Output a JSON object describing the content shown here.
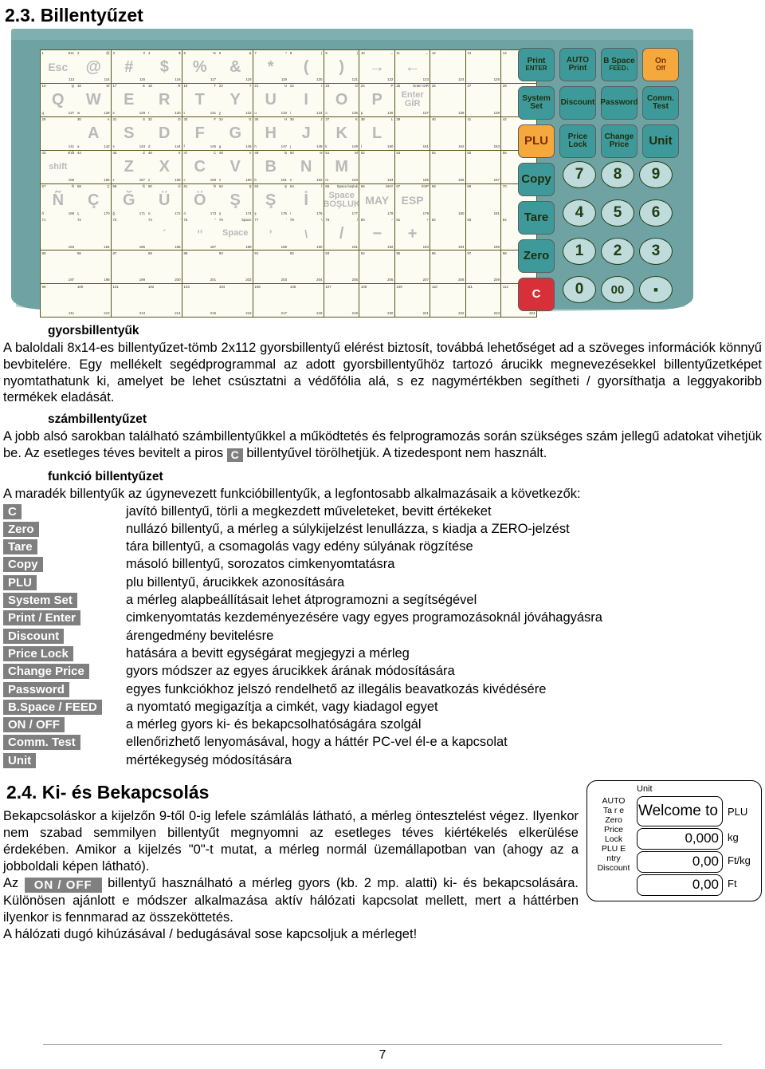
{
  "section_23": {
    "heading": "2.3. Billentyűzet"
  },
  "keyboard": {
    "matrix_rows": [
      [
        {
          "tl": "1",
          "tr": "Esc",
          "br": "113",
          "glyph": "Esc",
          "size": "md"
        },
        {
          "tl": "2",
          "tr": "@",
          "br": "114",
          "glyph": "@"
        },
        {
          "tl": "3",
          "tr": "#",
          "br": "115",
          "glyph": "#"
        },
        {
          "tl": "4",
          "tr": "$",
          "br": "116",
          "glyph": "$"
        },
        {
          "tl": "5",
          "tr": "%",
          "br": "117",
          "glyph": "%"
        },
        {
          "tl": "6",
          "tr": "&",
          "br": "118",
          "glyph": "&"
        },
        {
          "tl": "7",
          "tr": "*",
          "br": "119",
          "glyph": "*"
        },
        {
          "tl": "8",
          "tr": "(",
          "br": "120",
          "glyph": "("
        },
        {
          "tl": "9",
          "tr": ")",
          "br": "121",
          "glyph": ")"
        },
        {
          "tl": "10",
          "tr": "→",
          "br": "122",
          "glyph": "→"
        },
        {
          "tl": "11",
          "tr": "←",
          "br": "123",
          "glyph": "←"
        },
        {
          "tl": "12",
          "tr": "",
          "br": "124",
          "glyph": ""
        },
        {
          "tl": "13",
          "tr": "",
          "br": "125",
          "glyph": ""
        },
        {
          "tl": "14",
          "tr": "",
          "br": "126",
          "glyph": ""
        }
      ],
      [
        {
          "tl": "15",
          "tr": "Q",
          "bl": "q",
          "br": "127",
          "glyph": "Q"
        },
        {
          "tl": "16",
          "tr": "W",
          "bl": "w",
          "br": "128",
          "glyph": "W"
        },
        {
          "tl": "17",
          "tr": "E",
          "bl": "e",
          "br": "129",
          "glyph": "E"
        },
        {
          "tl": "18",
          "tr": "R",
          "bl": "r",
          "br": "130",
          "glyph": "R"
        },
        {
          "tl": "19",
          "tr": "T",
          "bl": "t",
          "br": "131",
          "glyph": "T"
        },
        {
          "tl": "20",
          "tr": "Y",
          "bl": "y",
          "br": "132",
          "glyph": "Y"
        },
        {
          "tl": "21",
          "tr": "U",
          "bl": "u",
          "br": "133",
          "glyph": "U"
        },
        {
          "tl": "22",
          "tr": "I",
          "bl": "i",
          "br": "134",
          "glyph": "I"
        },
        {
          "tl": "23",
          "tr": "O",
          "bl": "o",
          "br": "135",
          "glyph": "O"
        },
        {
          "tl": "24",
          "tr": "P",
          "bl": "p",
          "br": "136",
          "glyph": "P"
        },
        {
          "tl": "25",
          "tr": "Enter GIR",
          "br": "137",
          "glyph": "Enter GİR",
          "size": "sm"
        },
        {
          "tl": "26",
          "tr": "",
          "br": "138",
          "glyph": ""
        },
        {
          "tl": "27",
          "tr": "",
          "br": "139",
          "glyph": ""
        },
        {
          "tl": "28",
          "tr": "",
          "br": "140",
          "glyph": ""
        }
      ],
      [
        {
          "tl": "29",
          "tr": "",
          "br": "141",
          "glyph": ""
        },
        {
          "tl": "30",
          "tr": "A",
          "bl": "a",
          "br": "142",
          "glyph": "A"
        },
        {
          "tl": "31",
          "tr": "S",
          "bl": "s",
          "br": "143",
          "glyph": "S"
        },
        {
          "tl": "32",
          "tr": "D",
          "bl": "d",
          "br": "144",
          "glyph": "D"
        },
        {
          "tl": "33",
          "tr": "F",
          "bl": "f",
          "br": "145",
          "glyph": "F"
        },
        {
          "tl": "34",
          "tr": "G",
          "bl": "g",
          "br": "146",
          "glyph": "G"
        },
        {
          "tl": "35",
          "tr": "H",
          "bl": "h",
          "br": "147",
          "glyph": "H"
        },
        {
          "tl": "36",
          "tr": "J",
          "bl": "j",
          "br": "148",
          "glyph": "J"
        },
        {
          "tl": "37",
          "tr": "K",
          "bl": "k",
          "br": "149",
          "glyph": "K"
        },
        {
          "tl": "38",
          "tr": "L",
          "bl": "l",
          "br": "150",
          "glyph": "L"
        },
        {
          "tl": "39",
          "tr": "",
          "br": "151",
          "glyph": ""
        },
        {
          "tl": "40",
          "tr": "",
          "br": "152",
          "glyph": ""
        },
        {
          "tl": "41",
          "tr": "",
          "br": "153",
          "glyph": ""
        },
        {
          "tl": "42",
          "tr": "",
          "br": "154",
          "glyph": ""
        }
      ],
      [
        {
          "tl": "43",
          "tr": "shift",
          "br": "155",
          "glyph": "shift",
          "size": "sm"
        },
        {
          "tl": "44",
          "tr": "",
          "br": "156",
          "glyph": ""
        },
        {
          "tl": "45",
          "tr": "Z",
          "bl": "z",
          "br": "157",
          "glyph": "Z"
        },
        {
          "tl": "46",
          "tr": "X",
          "bl": "x",
          "br": "158",
          "glyph": "X"
        },
        {
          "tl": "47",
          "tr": "C",
          "bl": "c",
          "br": "159",
          "glyph": "C"
        },
        {
          "tl": "48",
          "tr": "V",
          "bl": "v",
          "br": "160",
          "glyph": "V"
        },
        {
          "tl": "49",
          "tr": "B",
          "bl": "b",
          "br": "161",
          "glyph": "B"
        },
        {
          "tl": "50",
          "tr": "N",
          "bl": "n",
          "br": "162",
          "glyph": "N"
        },
        {
          "tl": "51",
          "tr": "M",
          "bl": "m",
          "br": "163",
          "glyph": "M"
        },
        {
          "tl": "52",
          "tr": "",
          "br": "164",
          "glyph": ""
        },
        {
          "tl": "53",
          "tr": "",
          "br": "165",
          "glyph": ""
        },
        {
          "tl": "54",
          "tr": "",
          "br": "166",
          "glyph": ""
        },
        {
          "tl": "55",
          "tr": "",
          "br": "167",
          "glyph": ""
        },
        {
          "tl": "56",
          "tr": "",
          "br": "168",
          "glyph": ""
        }
      ],
      [
        {
          "tl": "57",
          "tr": "Ñ",
          "bl": "ñ",
          "br": "169",
          "glyph": "Ñ"
        },
        {
          "tl": "58",
          "tr": "Ç",
          "bl": "ç",
          "br": "170",
          "glyph": "Ç"
        },
        {
          "tl": "59",
          "tr": "Ğ",
          "bl": "ğ",
          "br": "171",
          "glyph": "Ğ"
        },
        {
          "tl": "60",
          "tr": "Ü",
          "bl": "ü",
          "br": "172",
          "glyph": "Ü"
        },
        {
          "tl": "61",
          "tr": "Ö",
          "bl": "ö",
          "br": "173",
          "glyph": "Ö"
        },
        {
          "tl": "62",
          "tr": "Ş",
          "bl": "ş",
          "br": "174",
          "glyph": "Ş"
        },
        {
          "tl": "63",
          "tr": "Ş",
          "bl": "ş",
          "br": "175",
          "glyph": "Ş"
        },
        {
          "tl": "64",
          "tr": "İ",
          "bl": "i",
          "br": "176",
          "glyph": "İ"
        },
        {
          "tl": "65",
          "tr": "Space boşluk",
          "br": "177",
          "glyph": "Space BOŞLUK",
          "size": "sm"
        },
        {
          "tl": "66",
          "tr": "MAY",
          "br": "178",
          "glyph": "MAY",
          "size": "md"
        },
        {
          "tl": "67",
          "tr": "ESP",
          "br": "179",
          "glyph": "ESP",
          "size": "md"
        },
        {
          "tl": "68",
          "tr": "",
          "br": "180",
          "glyph": ""
        },
        {
          "tl": "69",
          "tr": "",
          "br": "181",
          "glyph": ""
        },
        {
          "tl": "70",
          "tr": "",
          "br": "182",
          "glyph": ""
        }
      ],
      [
        {
          "tl": "71",
          "tr": "",
          "br": "183",
          "glyph": ""
        },
        {
          "tl": "72",
          "tr": "",
          "br": "184",
          "glyph": ""
        },
        {
          "tl": "73",
          "tr": "",
          "br": "185",
          "glyph": ""
        },
        {
          "tl": "74",
          "tr": "'",
          "br": "186",
          "glyph": "´",
          "size": "md"
        },
        {
          "tl": "75",
          "tr": "\"",
          "br": "187",
          "glyph": "’’",
          "size": "md"
        },
        {
          "tl": "76",
          "tr": "Space",
          "br": "188",
          "glyph": "Space",
          "size": "sm"
        },
        {
          "tl": "77",
          "tr": "'",
          "br": "189",
          "glyph": "’",
          "size": "md"
        },
        {
          "tl": "78",
          "tr": "\\",
          "br": "190",
          "glyph": "\\",
          "size": "md"
        },
        {
          "tl": "79",
          "tr": "/",
          "br": "191",
          "glyph": "/"
        },
        {
          "tl": "80",
          "tr": "−",
          "br": "192",
          "glyph": "−"
        },
        {
          "tl": "81",
          "tr": "+",
          "br": "193",
          "glyph": "+"
        },
        {
          "tl": "82",
          "tr": "",
          "br": "194",
          "glyph": ""
        },
        {
          "tl": "83",
          "tr": "",
          "br": "195",
          "glyph": ""
        },
        {
          "tl": "84",
          "tr": "",
          "br": "196",
          "glyph": ""
        }
      ],
      [
        {
          "tl": "85",
          "tr": "",
          "br": "197",
          "glyph": ""
        },
        {
          "tl": "86",
          "tr": "",
          "br": "198",
          "glyph": ""
        },
        {
          "tl": "87",
          "tr": "",
          "br": "199",
          "glyph": ""
        },
        {
          "tl": "88",
          "tr": "",
          "br": "200",
          "glyph": ""
        },
        {
          "tl": "89",
          "tr": "",
          "br": "201",
          "glyph": ""
        },
        {
          "tl": "90",
          "tr": "",
          "br": "202",
          "glyph": ""
        },
        {
          "tl": "91",
          "tr": "",
          "br": "203",
          "glyph": ""
        },
        {
          "tl": "92",
          "tr": "",
          "br": "204",
          "glyph": ""
        },
        {
          "tl": "93",
          "tr": "",
          "br": "205",
          "glyph": ""
        },
        {
          "tl": "94",
          "tr": "",
          "br": "206",
          "glyph": ""
        },
        {
          "tl": "95",
          "tr": "",
          "br": "207",
          "glyph": ""
        },
        {
          "tl": "96",
          "tr": "",
          "br": "208",
          "glyph": ""
        },
        {
          "tl": "97",
          "tr": "",
          "br": "209",
          "glyph": ""
        },
        {
          "tl": "98",
          "tr": "",
          "br": "210",
          "glyph": ""
        }
      ],
      [
        {
          "tl": "99",
          "tr": "",
          "br": "211",
          "glyph": ""
        },
        {
          "tl": "100",
          "tr": "",
          "br": "212",
          "glyph": ""
        },
        {
          "tl": "101",
          "tr": "",
          "br": "213",
          "glyph": ""
        },
        {
          "tl": "102",
          "tr": "",
          "br": "214",
          "glyph": ""
        },
        {
          "tl": "103",
          "tr": "",
          "br": "215",
          "glyph": ""
        },
        {
          "tl": "104",
          "tr": "",
          "br": "216",
          "glyph": ""
        },
        {
          "tl": "105",
          "tr": "",
          "br": "217",
          "glyph": ""
        },
        {
          "tl": "106",
          "tr": "",
          "br": "218",
          "glyph": ""
        },
        {
          "tl": "107",
          "tr": "",
          "br": "219",
          "glyph": ""
        },
        {
          "tl": "108",
          "tr": "",
          "br": "220",
          "glyph": ""
        },
        {
          "tl": "109",
          "tr": "",
          "br": "221",
          "glyph": ""
        },
        {
          "tl": "110",
          "tr": "",
          "br": "222",
          "glyph": ""
        },
        {
          "tl": "111",
          "tr": "",
          "br": "223",
          "glyph": ""
        },
        {
          "tl": "112",
          "tr": "",
          "br": "224",
          "glyph": ""
        }
      ]
    ],
    "function_keys": [
      {
        "name": "print-enter",
        "line1": "Print",
        "line2": "ENTER",
        "color": "teal"
      },
      {
        "name": "auto-print",
        "line1": "AUTO",
        "line2": "Print",
        "color": "teal",
        "l2big": true
      },
      {
        "name": "bspace-feed",
        "line1": "B Space",
        "line2": "FEED↓",
        "color": "teal",
        "small": true
      },
      {
        "name": "on-off",
        "line1": "On",
        "line2": "Off",
        "color": "orange"
      },
      {
        "name": "system-set",
        "line1": "System",
        "line2": "Set",
        "color": "teal",
        "l2big": true
      },
      {
        "name": "discount",
        "line1": "Discount",
        "line2": "",
        "color": "teal",
        "small": true
      },
      {
        "name": "password",
        "line1": "Password",
        "line2": "",
        "color": "teal",
        "small": true
      },
      {
        "name": "comm-test",
        "line1": "Comm.",
        "line2": "Test",
        "color": "teal",
        "l2big": true
      },
      {
        "name": "plu",
        "line1": "PLU",
        "line2": "",
        "color": "orange",
        "big": true
      },
      {
        "name": "price-lock",
        "line1": "Price",
        "line2": "Lock",
        "color": "teal",
        "l2big": true
      },
      {
        "name": "change-price",
        "line1": "Change",
        "line2": "Price",
        "color": "teal",
        "l2big": true
      },
      {
        "name": "unit",
        "line1": "Unit",
        "line2": "",
        "color": "teal",
        "big": true
      },
      {
        "name": "copy",
        "line1": "Copy",
        "line2": "",
        "color": "teal",
        "big": true
      },
      {
        "name": "tare",
        "line1": "Tare",
        "line2": "",
        "color": "teal",
        "big": true
      },
      {
        "name": "zero",
        "line1": "Zero",
        "line2": "",
        "color": "teal",
        "big": true
      },
      {
        "name": "clear",
        "line1": "C",
        "line2": "",
        "color": "red",
        "big": true
      }
    ],
    "numpad": [
      "7",
      "8",
      "9",
      "4",
      "5",
      "6",
      "1",
      "2",
      "3",
      "0",
      "00",
      "."
    ]
  },
  "quick_keys": {
    "subheading": "gyorsbillentyűk",
    "paragraph": "A baloldali 8x14-es billentyűzet-tömb 2x112 gyorsbillentyű elérést biztosít, továbbá lehetőséget ad a szöveges információk könnyű bevbitelére. Egy mellékelt segédprogrammal az adott gyorsbillentyűhöz tartozó árucikk megnevezésekkel billentyűzetképet nyomtathatunk ki, amelyet be lehet csúsztatni a védőfólia alá, s ez nagymértékben segítheti / gyorsíthatja a leggyakoribb termékek eladását."
  },
  "num_keys": {
    "subheading": "számbillentyűzet",
    "part1": "A jobb alsó sarokban található számbillentyűkkel a működtetés és felprogramozás során szükséges szám jellegű adatokat vihetjük be. Az esetleges téves bevitelt a piros ",
    "badge": "C",
    "part2": " billentyűvel törölhetjük. A tizedespont nem használt."
  },
  "function_keys_section": {
    "subheading": "funkció billentyűzet",
    "intro": "A maradék billentyűk az úgynevezett funkcióbillentyűk, a legfontosabb alkalmazásaik a következők:",
    "rows": [
      {
        "key": "C",
        "desc": "javító billentyű, törli a megkezdett műveleteket, bevitt értékeket"
      },
      {
        "key": "Zero",
        "desc": "nullázó billentyű, a mérleg a súlykijelzést lenullázza, s kiadja a ZERO-jelzést"
      },
      {
        "key": "Tare",
        "desc": "tára billentyű, a csomagolás vagy edény súlyának rögzítése"
      },
      {
        "key": "Copy",
        "desc": "másoló billentyű, sorozatos cimkenyomtatásra"
      },
      {
        "key": "PLU",
        "desc": "plu billentyű, árucikkek azonosítására"
      },
      {
        "key": "System Set",
        "desc": "a mérleg alapbeállításait lehet átprogramozni a segítségével"
      },
      {
        "key": "Print / Enter",
        "desc": "cimkenyomtatás kezdeményezésére vagy egyes programozásoknál jóváhagyásra"
      },
      {
        "key": "Discount",
        "desc": "árengedmény bevitelésre"
      },
      {
        "key": "Price Lock",
        "desc": "hatására a bevitt egységárat megjegyzi a mérleg"
      },
      {
        "key": "Change Price",
        "desc": "gyors módszer az egyes árucikkek árának módosítására"
      },
      {
        "key": "Password",
        "desc": "egyes funkciókhoz jelszó rendelhető az illegális beavatkozás kivédésére"
      },
      {
        "key": "B.Space / FEED",
        "desc": "a nyomtató megigazítja a cimkét, vagy kiadagol egyet"
      },
      {
        "key": "ON / OFF",
        "desc": "a mérleg gyors ki- és bekapcsolhatóságára szolgál"
      },
      {
        "key": "Comm. Test",
        "desc": "ellenőrizhető lenyomásával, hogy a háttér PC-vel él-e a kapcsolat"
      },
      {
        "key": "Unit",
        "desc": "mértékegység módosítására"
      }
    ]
  },
  "section_24": {
    "heading": "2.4. Ki- és Bekapcsolás",
    "part1": "Bekapcsoláskor a kijelzőn 9-től 0-ig lefele számlálás látható, a mérleg öntesztelést végez. Ilyenkor nem szabad semmilyen billentyűt megnyomni az esetleges téves kiértékelés elkerülése érdekében. Amikor a kijelzés \"0\"-t mutat, a mérleg normál üzemállapotban van (ahogy az a jobboldali képen látható).",
    "az": "Az ",
    "badge": "ON / OFF",
    "part2": " billentyű használható a mérleg gyors (kb. 2 mp. alatti) ki- és bekapcsolására. Különösen ajánlott e módszer alkalmazása aktív hálózati kapcsolat mellett, mert a háttérben ilyenkor is fennmarad az összeköttetés.",
    "part3": "A hálózati dugó kihúzásával / bedugásával sose kapcsoljuk a mérleget!"
  },
  "display": {
    "unit_label": "Unit",
    "indicators": [
      "AUTO",
      "Ta r e",
      "Zero",
      "Price\nLock",
      "PLU E\nntry",
      "Discount"
    ],
    "fields": [
      {
        "value": "Welcome to",
        "unit": "PLU"
      },
      {
        "value": "0,000",
        "unit": "kg"
      },
      {
        "value": "0,00",
        "unit": "Ft/kg"
      },
      {
        "value": "0,00",
        "unit": "Ft"
      }
    ]
  },
  "footer": {
    "page_number": "7"
  }
}
